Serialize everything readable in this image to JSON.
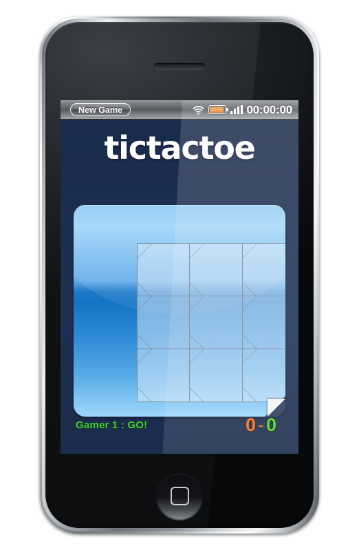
{
  "device": {
    "name": "smartphone-mockup",
    "speaker": "earpiece-speaker",
    "home_button": "home-button"
  },
  "status_bar": {
    "new_game_label": "New Game",
    "wifi_icon": "wifi-icon",
    "battery_icon": "battery-icon",
    "signal_icon": "signal-bars-icon",
    "clock": "00:00:00"
  },
  "app": {
    "title": "tictactoe",
    "background_color": "#1b2c4d",
    "title_color": "#ffffff"
  },
  "board": {
    "name": "tictactoe-board",
    "rows": 3,
    "cols": 3,
    "cells": [
      {
        "index": 0,
        "value": "",
        "label": "cell-1-1"
      },
      {
        "index": 1,
        "value": "",
        "label": "cell-1-2"
      },
      {
        "index": 2,
        "value": "",
        "label": "cell-1-3"
      },
      {
        "index": 3,
        "value": "",
        "label": "cell-2-1"
      },
      {
        "index": 4,
        "value": "",
        "label": "cell-2-2"
      },
      {
        "index": 5,
        "value": "",
        "label": "cell-2-3"
      },
      {
        "index": 6,
        "value": "",
        "label": "cell-3-1"
      },
      {
        "index": 7,
        "value": "",
        "label": "cell-3-2"
      },
      {
        "index": 8,
        "value": "",
        "label": "cell-3-3"
      }
    ],
    "card_color_top": "#8ecdf8",
    "card_color_mid": "#1473c4",
    "card_color_bottom": "#9fd6fa",
    "grid_line_color": "#7b8a99",
    "page_curl": "page-curl"
  },
  "footer": {
    "turn_text": "Gamer 1 : GO!",
    "turn_color": "#3fd61e",
    "score_player1": "0",
    "score_separator": "-",
    "score_player2": "0",
    "score_player1_color": "#ff6a13",
    "score_player2_color": "#49d61b"
  }
}
